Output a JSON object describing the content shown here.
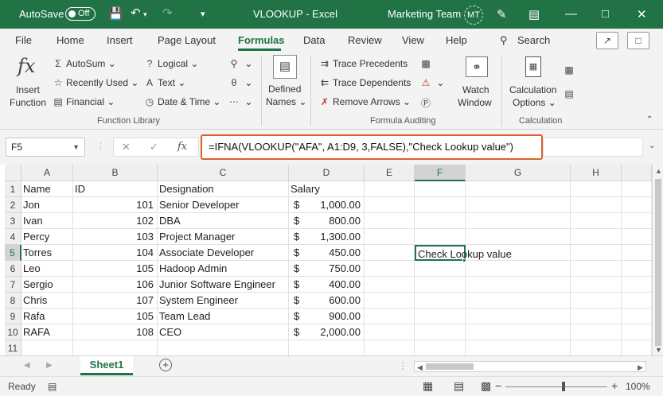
{
  "titlebar": {
    "autosave_label": "AutoSave",
    "autosave_state": "Off",
    "doc_title": "VLOOKUP  -  Excel",
    "team": "Marketing Team",
    "user_initials": "MT"
  },
  "tabs": [
    "File",
    "Home",
    "Insert",
    "Page Layout",
    "Formulas",
    "Data",
    "Review",
    "View",
    "Help"
  ],
  "active_tab": "Formulas",
  "search_label": "Search",
  "ribbon": {
    "insert_function": [
      "Insert",
      "Function"
    ],
    "autosum": "AutoSum",
    "recently_used": "Recently Used",
    "financial": "Financial",
    "logical": "Logical",
    "text": "Text",
    "date_time": "Date & Time",
    "defined_names": [
      "Defined",
      "Names"
    ],
    "trace_precedents": "Trace Precedents",
    "trace_dependents": "Trace Dependents",
    "remove_arrows": "Remove Arrows",
    "watch_window": [
      "Watch",
      "Window"
    ],
    "calc_options": [
      "Calculation",
      "Options"
    ],
    "group_function_library": "Function Library",
    "group_formula_auditing": "Formula Auditing",
    "group_calculation": "Calculation"
  },
  "formula_bar": {
    "name_box": "F5",
    "formula": "=IFNA(VLOOKUP(\"AFA\", A1:D9, 3,FALSE),\"Check Lookup value\")"
  },
  "columns": [
    "A",
    "B",
    "C",
    "D",
    "E",
    "F",
    "G",
    "H"
  ],
  "rows": [
    {
      "n": "1",
      "a": "Name",
      "b": "ID",
      "c": "Designation",
      "d_cur": "",
      "d": "Salary",
      "f": ""
    },
    {
      "n": "2",
      "a": "Jon",
      "b": "101",
      "c": "Senior Developer",
      "d_cur": "$",
      "d": "1,000.00",
      "f": ""
    },
    {
      "n": "3",
      "a": "Ivan",
      "b": "102",
      "c": "DBA",
      "d_cur": "$",
      "d": "800.00",
      "f": ""
    },
    {
      "n": "4",
      "a": "Percy",
      "b": "103",
      "c": "Project Manager",
      "d_cur": "$",
      "d": "1,300.00",
      "f": ""
    },
    {
      "n": "5",
      "a": "Torres",
      "b": "104",
      "c": "Associate Developer",
      "d_cur": "$",
      "d": "450.00",
      "f": "Check Lookup value"
    },
    {
      "n": "6",
      "a": "Leo",
      "b": "105",
      "c": "Hadoop Admin",
      "d_cur": "$",
      "d": "750.00",
      "f": ""
    },
    {
      "n": "7",
      "a": "Sergio",
      "b": "106",
      "c": "Junior Software Engineer",
      "d_cur": "$",
      "d": "400.00",
      "f": ""
    },
    {
      "n": "8",
      "a": "Chris",
      "b": "107",
      "c": "System Engineer",
      "d_cur": "$",
      "d": "600.00",
      "f": ""
    },
    {
      "n": "9",
      "a": "Rafa",
      "b": "105",
      "c": "Team Lead",
      "d_cur": "$",
      "d": "900.00",
      "f": ""
    },
    {
      "n": "10",
      "a": "RAFA",
      "b": "108",
      "c": "CEO",
      "d_cur": "$",
      "d": "2,000.00",
      "f": ""
    },
    {
      "n": "11",
      "a": "",
      "b": "",
      "c": "",
      "d_cur": "",
      "d": "",
      "f": ""
    }
  ],
  "sheet_tab": "Sheet1",
  "status": {
    "ready": "Ready",
    "zoom": "100%"
  },
  "colors": {
    "accent": "#217346",
    "highlight_border": "#d9622b"
  }
}
